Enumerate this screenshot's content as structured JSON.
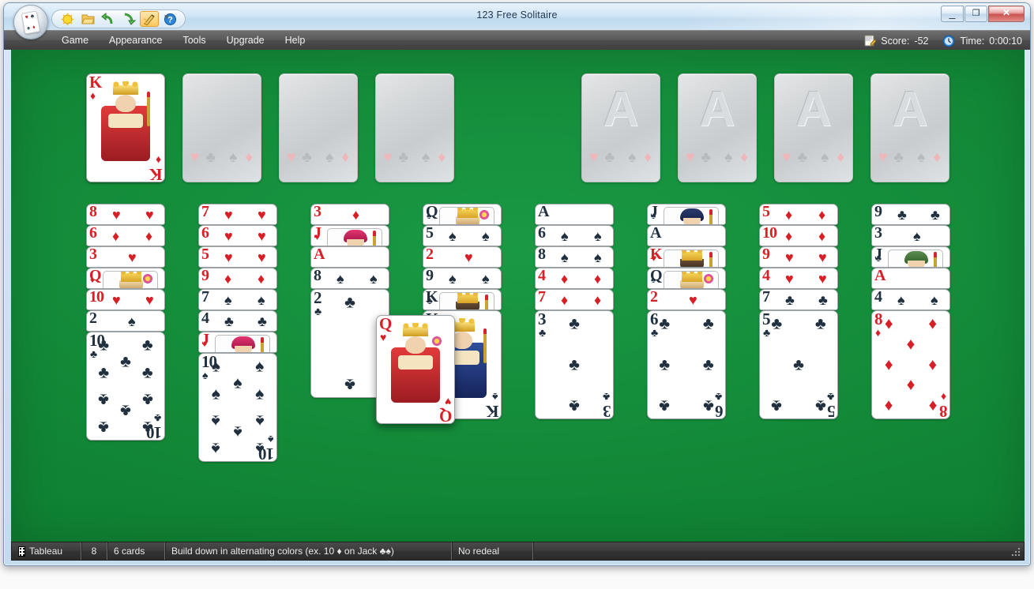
{
  "window": {
    "title": "123 Free Solitaire",
    "controls": {
      "minimize": "—",
      "maximize": "❐",
      "close": "✕"
    }
  },
  "toolbar": {
    "buttons": [
      {
        "name": "new-game-icon",
        "glyph": "☀",
        "color": "#f0c11e"
      },
      {
        "name": "open-game-icon",
        "glyph": "📁",
        "color": "#e8b84b"
      },
      {
        "name": "undo-icon",
        "glyph": "↶",
        "color": "#3c9a3c"
      },
      {
        "name": "redo-icon",
        "glyph": "↷",
        "color": "#3c9a3c"
      },
      {
        "name": "auto-play-icon",
        "glyph": "🪄",
        "color": "#c08a22"
      },
      {
        "name": "help-icon",
        "glyph": "?",
        "color": "#1f74c8"
      }
    ],
    "overflow": "▾"
  },
  "menubar": {
    "items": [
      "Game",
      "Appearance",
      "Tools",
      "Upgrade",
      "Help"
    ]
  },
  "status_right": {
    "score_label": "Score:",
    "score_value": "-52",
    "time_label": "Time:",
    "time_value": "0:00:10"
  },
  "statusbar": {
    "area": "Tableau",
    "count": "8",
    "cards": "6 cards",
    "rule": "Build down in alternating colors (ex. 10 ♦ on Jack ♣♠)",
    "redeal": "No redeal"
  },
  "board": {
    "free_cells": [
      {
        "name": "free-cell-1",
        "card": {
          "rank": "K",
          "suit": "♦",
          "color": "red"
        }
      },
      {
        "name": "free-cell-2",
        "card": null
      },
      {
        "name": "free-cell-3",
        "card": null
      },
      {
        "name": "free-cell-4",
        "card": null
      }
    ],
    "foundations": [
      {
        "name": "foundation-1",
        "watermark": "A",
        "card": null
      },
      {
        "name": "foundation-2",
        "watermark": "A",
        "card": null
      },
      {
        "name": "foundation-3",
        "watermark": "A",
        "card": null
      },
      {
        "name": "foundation-4",
        "watermark": "A",
        "card": null
      }
    ],
    "slot_suits": [
      "♥",
      "♣",
      "♠",
      "♦"
    ],
    "tableau": [
      {
        "name": "tableau-column-1",
        "cards": [
          {
            "rank": "8",
            "suit": "♥",
            "color": "red"
          },
          {
            "rank": "6",
            "suit": "♦",
            "color": "red"
          },
          {
            "rank": "3",
            "suit": "♥",
            "color": "red"
          },
          {
            "rank": "Q",
            "suit": "♦",
            "color": "red"
          },
          {
            "rank": "10",
            "suit": "♥",
            "color": "red"
          },
          {
            "rank": "2",
            "suit": "♠",
            "color": "black"
          },
          {
            "rank": "10",
            "suit": "♣",
            "color": "black"
          }
        ]
      },
      {
        "name": "tableau-column-2",
        "cards": [
          {
            "rank": "7",
            "suit": "♥",
            "color": "red"
          },
          {
            "rank": "6",
            "suit": "♥",
            "color": "red"
          },
          {
            "rank": "5",
            "suit": "♥",
            "color": "red"
          },
          {
            "rank": "9",
            "suit": "♦",
            "color": "red"
          },
          {
            "rank": "7",
            "suit": "♠",
            "color": "black"
          },
          {
            "rank": "4",
            "suit": "♣",
            "color": "black"
          },
          {
            "rank": "J",
            "suit": "♦",
            "color": "red"
          },
          {
            "rank": "10",
            "suit": "♠",
            "color": "black"
          }
        ]
      },
      {
        "name": "tableau-column-3",
        "cards": [
          {
            "rank": "3",
            "suit": "♦",
            "color": "red"
          },
          {
            "rank": "J",
            "suit": "♥",
            "color": "red"
          },
          {
            "rank": "A",
            "suit": "♥",
            "color": "red"
          },
          {
            "rank": "8",
            "suit": "♠",
            "color": "black"
          },
          {
            "rank": "2",
            "suit": "♣",
            "color": "black"
          }
        ]
      },
      {
        "name": "tableau-column-4",
        "cards": [
          {
            "rank": "Q",
            "suit": "♠",
            "color": "black"
          },
          {
            "rank": "5",
            "suit": "♠",
            "color": "black"
          },
          {
            "rank": "2",
            "suit": "♥",
            "color": "red"
          },
          {
            "rank": "9",
            "suit": "♠",
            "color": "black"
          },
          {
            "rank": "K",
            "suit": "♣",
            "color": "black"
          },
          {
            "rank": "K",
            "suit": "♠",
            "color": "black"
          }
        ]
      },
      {
        "name": "tableau-column-5",
        "cards": [
          {
            "rank": "A",
            "suit": "♠",
            "color": "black"
          },
          {
            "rank": "6",
            "suit": "♠",
            "color": "black"
          },
          {
            "rank": "8",
            "suit": "♠",
            "color": "black"
          },
          {
            "rank": "4",
            "suit": "♦",
            "color": "red"
          },
          {
            "rank": "7",
            "suit": "♦",
            "color": "red"
          },
          {
            "rank": "3",
            "suit": "♣",
            "color": "black"
          }
        ]
      },
      {
        "name": "tableau-column-6",
        "cards": [
          {
            "rank": "J",
            "suit": "♠",
            "color": "black"
          },
          {
            "rank": "A",
            "suit": "♠",
            "color": "black"
          },
          {
            "rank": "K",
            "suit": "♥",
            "color": "red"
          },
          {
            "rank": "Q",
            "suit": "♠",
            "color": "black"
          },
          {
            "rank": "2",
            "suit": "♥",
            "color": "red"
          },
          {
            "rank": "6",
            "suit": "♣",
            "color": "black"
          }
        ]
      },
      {
        "name": "tableau-column-7",
        "cards": [
          {
            "rank": "5",
            "suit": "♦",
            "color": "red"
          },
          {
            "rank": "10",
            "suit": "♦",
            "color": "red"
          },
          {
            "rank": "9",
            "suit": "♥",
            "color": "red"
          },
          {
            "rank": "4",
            "suit": "♥",
            "color": "red"
          },
          {
            "rank": "7",
            "suit": "♣",
            "color": "black"
          },
          {
            "rank": "5",
            "suit": "♣",
            "color": "black"
          }
        ]
      },
      {
        "name": "tableau-column-8",
        "cards": [
          {
            "rank": "9",
            "suit": "♣",
            "color": "black"
          },
          {
            "rank": "3",
            "suit": "♠",
            "color": "black"
          },
          {
            "rank": "J",
            "suit": "♣",
            "color": "black"
          },
          {
            "rank": "A",
            "suit": "♦",
            "color": "red"
          },
          {
            "rank": "4",
            "suit": "♠",
            "color": "black"
          },
          {
            "rank": "8",
            "suit": "♦",
            "color": "red"
          }
        ]
      }
    ],
    "dragged_card": {
      "name": "dragged-card",
      "rank": "Q",
      "suit": "♥",
      "color": "red"
    }
  },
  "colors": {
    "felt": "#148a38",
    "red_suit": "#d81f26",
    "black_suit": "#20303f",
    "menu_bg": "#4d4d4d",
    "accent": "#fdc75c"
  }
}
